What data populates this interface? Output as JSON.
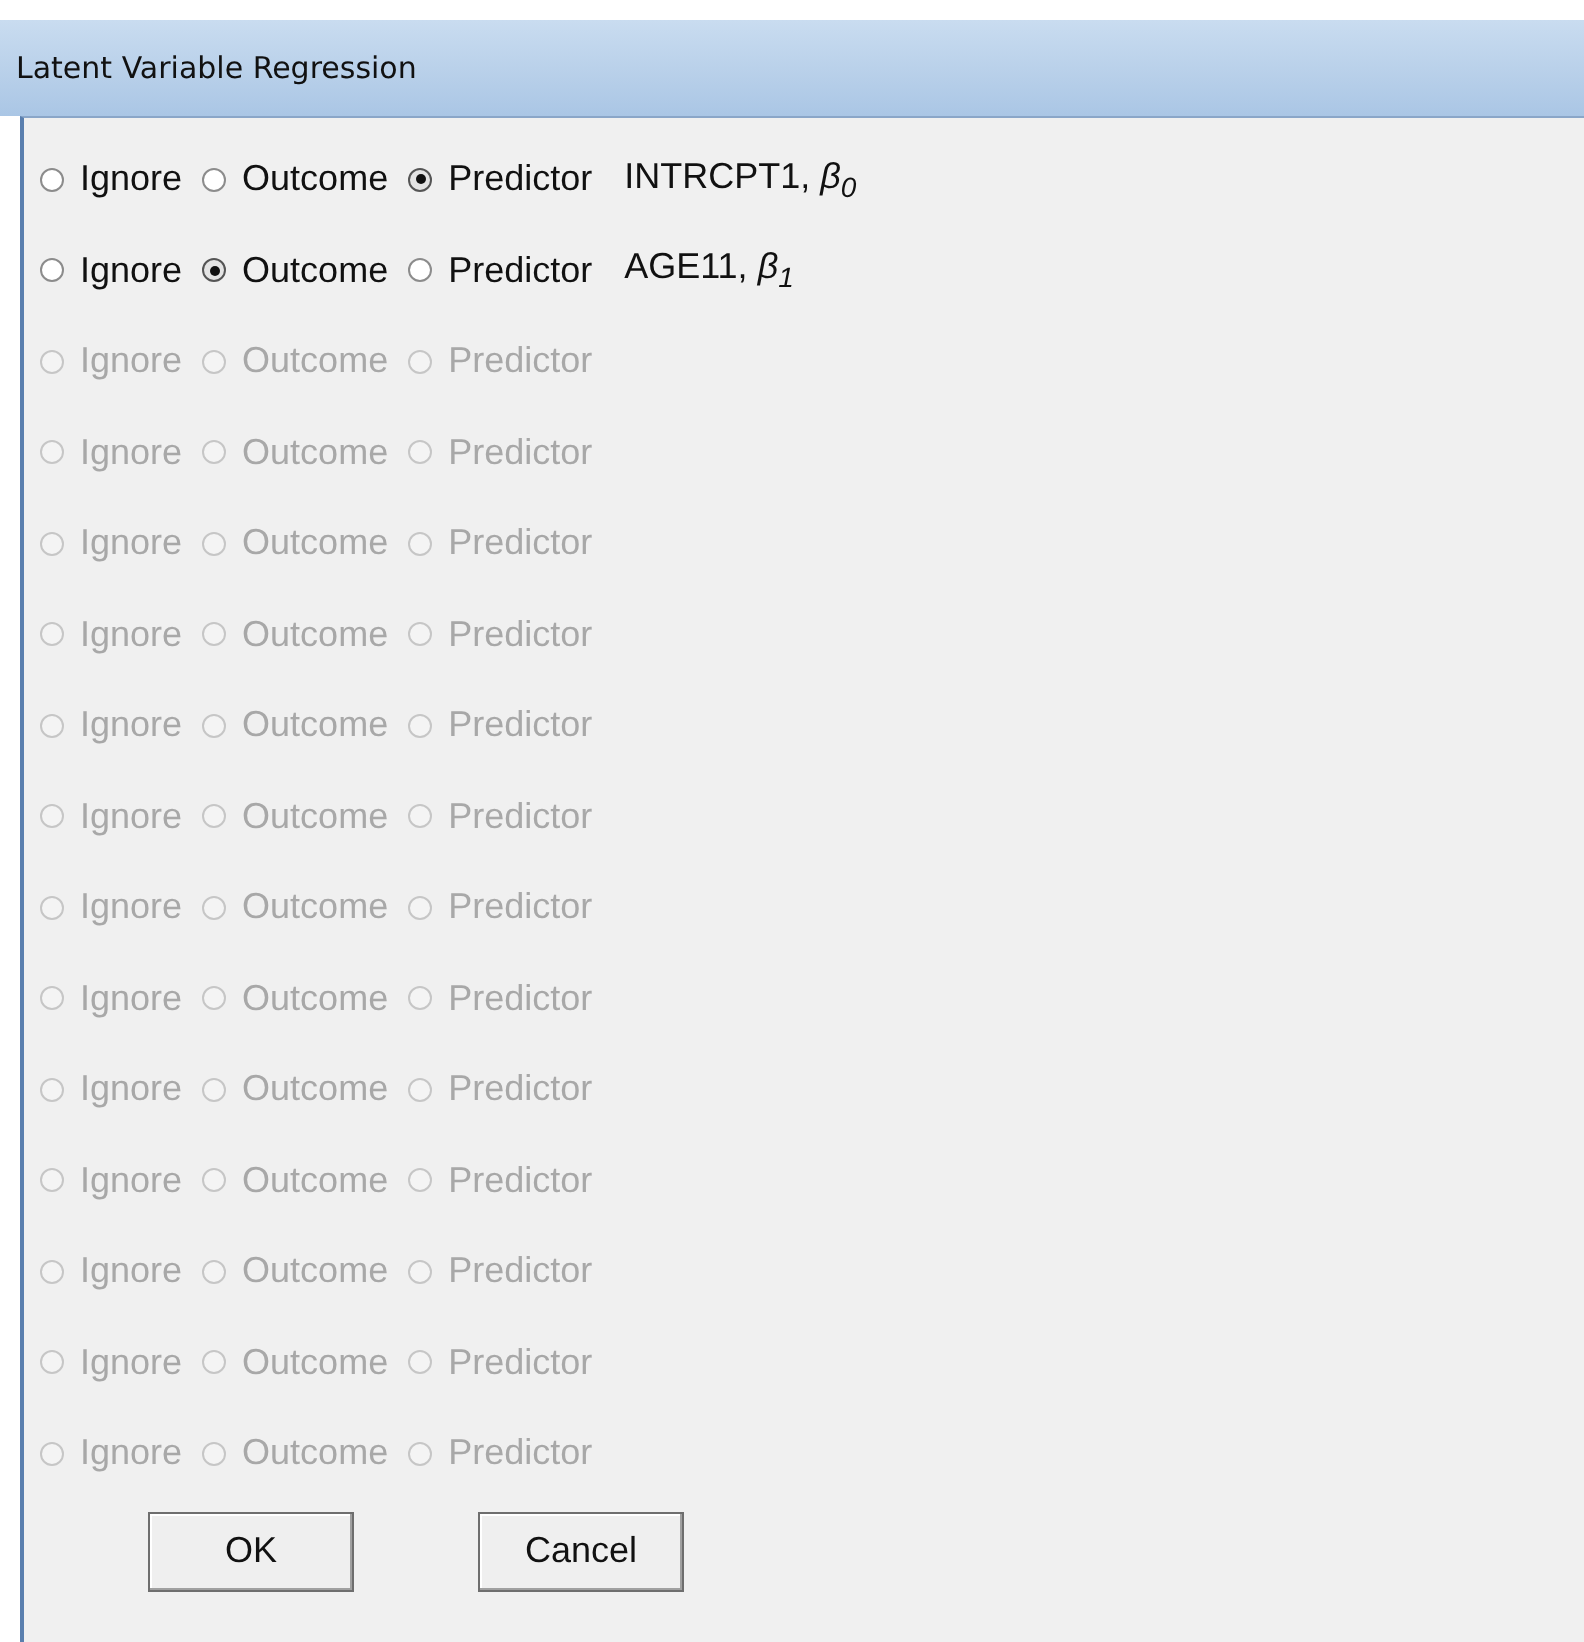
{
  "window": {
    "title": "Latent Variable Regression"
  },
  "rows": [
    {
      "disabled": false,
      "variable": "INTRCPT1, *β*$_{0}$",
      "options": [
        {
          "label": "Ignore",
          "selected": false
        },
        {
          "label": "Outcome",
          "selected": false
        },
        {
          "label": "Predictor",
          "selected": true
        }
      ]
    },
    {
      "disabled": false,
      "variable": "AGE11, *β*$_{1}$",
      "options": [
        {
          "label": "Ignore",
          "selected": false
        },
        {
          "label": "Outcome",
          "selected": true
        },
        {
          "label": "Predictor",
          "selected": false
        }
      ]
    },
    {
      "disabled": true,
      "options": [
        {
          "label": "Ignore",
          "selected": false
        },
        {
          "label": "Outcome",
          "selected": false
        },
        {
          "label": "Predictor",
          "selected": false
        }
      ]
    },
    {
      "disabled": true,
      "options": [
        {
          "label": "Ignore",
          "selected": false
        },
        {
          "label": "Outcome",
          "selected": false
        },
        {
          "label": "Predictor",
          "selected": false
        }
      ]
    },
    {
      "disabled": true,
      "options": [
        {
          "label": "Ignore",
          "selected": false
        },
        {
          "label": "Outcome",
          "selected": false
        },
        {
          "label": "Predictor",
          "selected": false
        }
      ]
    },
    {
      "disabled": true,
      "options": [
        {
          "label": "Ignore",
          "selected": false
        },
        {
          "label": "Outcome",
          "selected": false
        },
        {
          "label": "Predictor",
          "selected": false
        }
      ]
    },
    {
      "disabled": true,
      "options": [
        {
          "label": "Ignore",
          "selected": false
        },
        {
          "label": "Outcome",
          "selected": false
        },
        {
          "label": "Predictor",
          "selected": false
        }
      ]
    },
    {
      "disabled": true,
      "options": [
        {
          "label": "Ignore",
          "selected": false
        },
        {
          "label": "Outcome",
          "selected": false
        },
        {
          "label": "Predictor",
          "selected": false
        }
      ]
    },
    {
      "disabled": true,
      "options": [
        {
          "label": "Ignore",
          "selected": false
        },
        {
          "label": "Outcome",
          "selected": false
        },
        {
          "label": "Predictor",
          "selected": false
        }
      ]
    },
    {
      "disabled": true,
      "options": [
        {
          "label": "Ignore",
          "selected": false
        },
        {
          "label": "Outcome",
          "selected": false
        },
        {
          "label": "Predictor",
          "selected": false
        }
      ]
    },
    {
      "disabled": true,
      "options": [
        {
          "label": "Ignore",
          "selected": false
        },
        {
          "label": "Outcome",
          "selected": false
        },
        {
          "label": "Predictor",
          "selected": false
        }
      ]
    },
    {
      "disabled": true,
      "options": [
        {
          "label": "Ignore",
          "selected": false
        },
        {
          "label": "Outcome",
          "selected": false
        },
        {
          "label": "Predictor",
          "selected": false
        }
      ]
    },
    {
      "disabled": true,
      "options": [
        {
          "label": "Ignore",
          "selected": false
        },
        {
          "label": "Outcome",
          "selected": false
        },
        {
          "label": "Predictor",
          "selected": false
        }
      ]
    },
    {
      "disabled": true,
      "options": [
        {
          "label": "Ignore",
          "selected": false
        },
        {
          "label": "Outcome",
          "selected": false
        },
        {
          "label": "Predictor",
          "selected": false
        }
      ]
    },
    {
      "disabled": true,
      "options": [
        {
          "label": "Ignore",
          "selected": false
        },
        {
          "label": "Outcome",
          "selected": false
        },
        {
          "label": "Predictor",
          "selected": false
        }
      ]
    }
  ],
  "buttons": [
    "OK",
    "Cancel"
  ]
}
